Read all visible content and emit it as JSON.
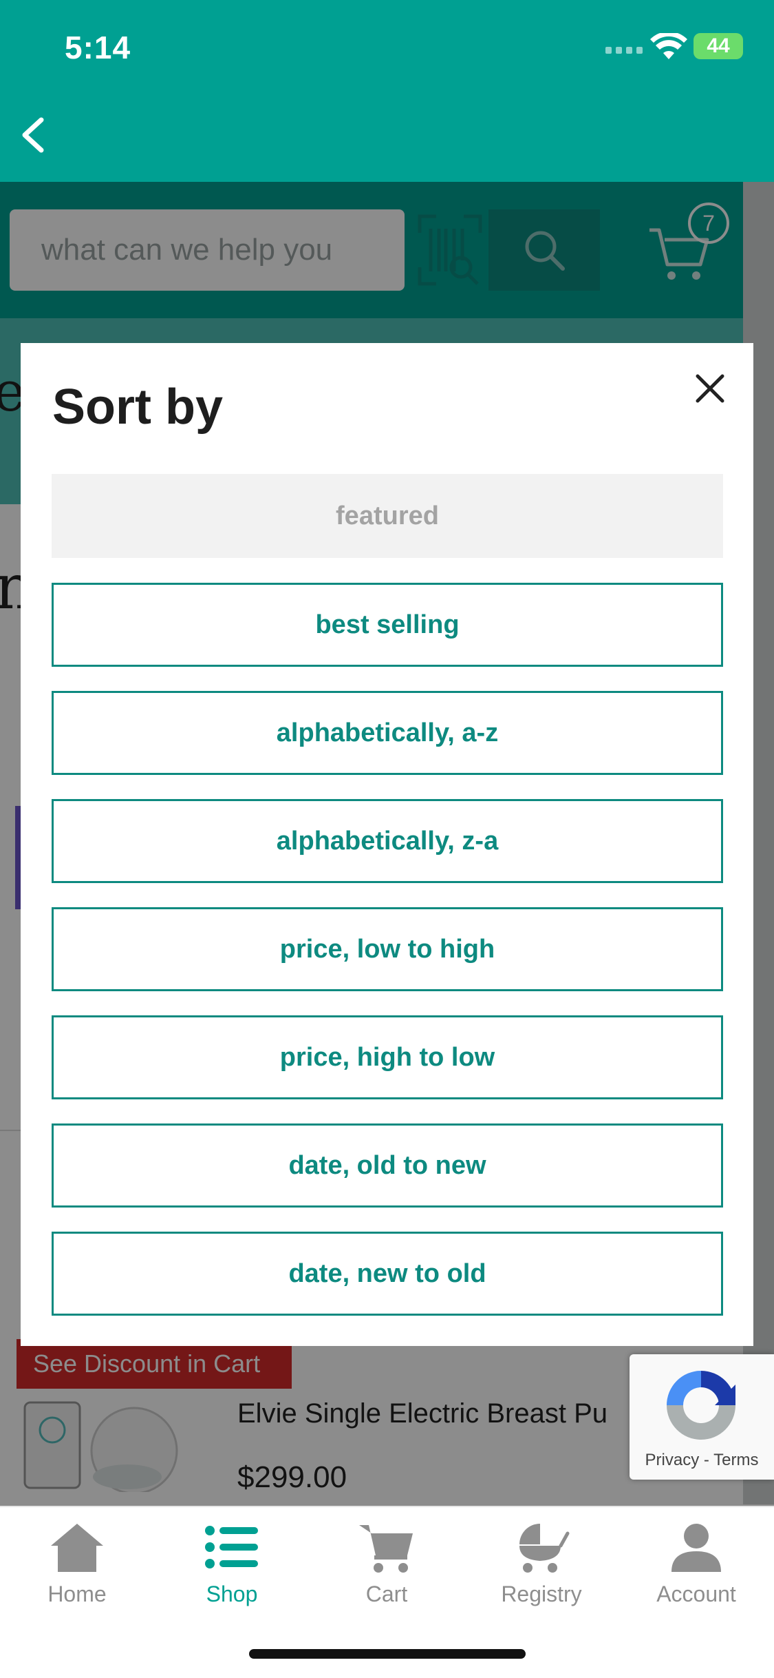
{
  "status_bar": {
    "time": "5:14",
    "battery": "44"
  },
  "search": {
    "placeholder": "what can we help you"
  },
  "cart": {
    "count": "7"
  },
  "modal": {
    "title": "Sort by",
    "options": [
      {
        "label": "featured",
        "selected": true
      },
      {
        "label": "best selling"
      },
      {
        "label": "alphabetically, a-z"
      },
      {
        "label": "alphabetically, z-a"
      },
      {
        "label": "price, low to high"
      },
      {
        "label": "price, high to low"
      },
      {
        "label": "date, old to new"
      },
      {
        "label": "date, new to old"
      }
    ]
  },
  "product": {
    "badge": "See Discount in Cart",
    "name": "Elvie Single Electric Breast Pu",
    "price": "$299.00"
  },
  "recaptcha": {
    "links": "Privacy - Terms"
  },
  "tabs": [
    {
      "label": "Home",
      "icon": "home-icon"
    },
    {
      "label": "Shop",
      "icon": "list-icon",
      "active": true
    },
    {
      "label": "Cart",
      "icon": "cart-icon"
    },
    {
      "label": "Registry",
      "icon": "stroller-icon"
    },
    {
      "label": "Account",
      "icon": "account-icon"
    }
  ],
  "colors": {
    "brand": "#00a092",
    "accent": "#0d8a80",
    "discount": "#d42b2b"
  }
}
